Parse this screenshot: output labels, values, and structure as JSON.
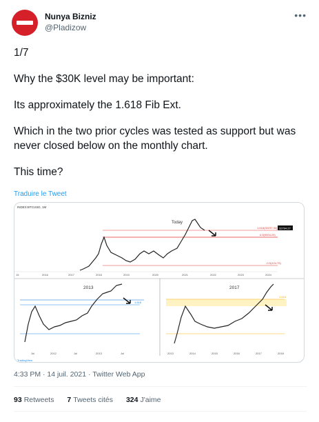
{
  "user": {
    "display_name": "Nunya Bizniz",
    "handle": "@Pladizow",
    "more_icon": "more-horizontal-icon"
  },
  "tweet": {
    "lines": [
      "1/7",
      "Why the $30K level may be important:",
      "Its approximately the 1.618 Fib Ext.",
      "Which in the two prior cycles was tested as support but was never closed below on the monthly chart.",
      "This time?"
    ],
    "translate": "Traduire le Tweet",
    "timestamp": "4:33 PM · 14 juil. 2021 · Twitter Web App"
  },
  "stats": {
    "retweets_count": "93",
    "retweets_label": "Retweets",
    "quotes_count": "7",
    "quotes_label": "Tweets cités",
    "likes_count": "324",
    "likes_label": "J'aime"
  },
  "chart": {
    "top_header": "INDEX:BTCUSD, 1M",
    "top_label": "Today",
    "fib_top": "1.618(30237.30)",
    "fib_mid": "0.5(9004.29)",
    "fib_bot": "-0.5(124.75)",
    "price_tag": "32794.27",
    "years_top": [
      "15",
      "2016",
      "2017",
      "2018",
      "2019",
      "2020",
      "2021",
      "2022",
      "2023",
      "2024"
    ],
    "left_label": "2013",
    "right_label": "2017",
    "left_fib": "1.618",
    "right_fib": "1.618",
    "years_left": [
      "Jul",
      "2012",
      "Jul",
      "2013",
      "Jul"
    ],
    "years_right": [
      "2013",
      "2014",
      "2015",
      "2016",
      "2017",
      "2018"
    ],
    "logo": "TradingView"
  }
}
